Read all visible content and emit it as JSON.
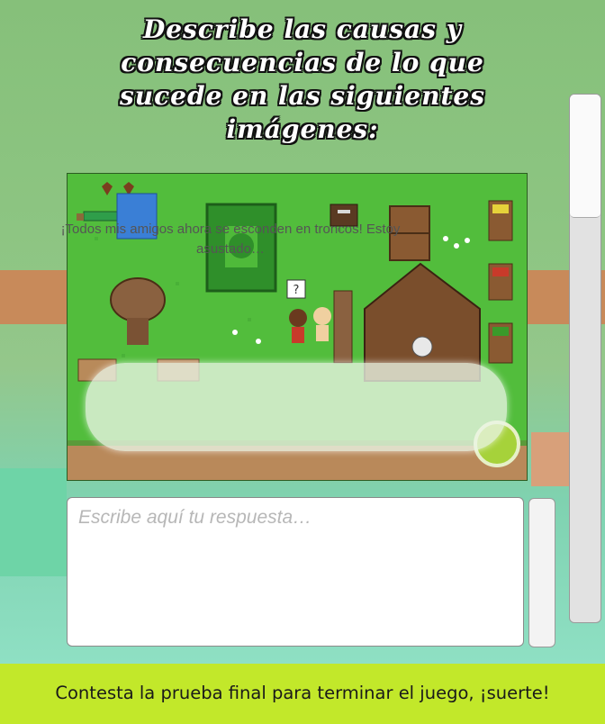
{
  "prompt": {
    "title": "Describe las causas y consecuencias de lo que sucede en las siguientes imágenes:"
  },
  "scene": {
    "dialog_text": "¡Todos mis amigos ahora se esconden en troncos! Estoy asustado…",
    "npc_bubble": "?"
  },
  "answer": {
    "placeholder": "Escribe aquí tu respuesta…"
  },
  "footer": {
    "message": "Contesta la prueba final para terminar el juego, ¡suerte!"
  },
  "colors": {
    "footer_bg": "#c2e82a",
    "grass": "#4fba3a"
  }
}
